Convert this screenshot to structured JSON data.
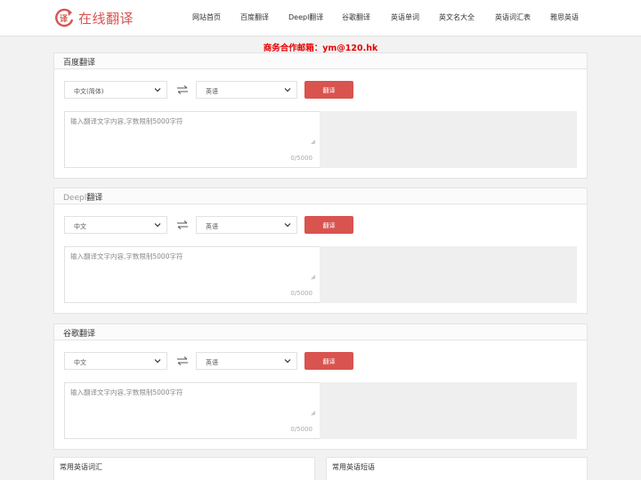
{
  "header": {
    "logo_text": "在线翻译",
    "logo_badge": "译",
    "nav": [
      "网站首页",
      "百度翻译",
      "Deepl翻译",
      "谷歌翻译",
      "英语单词",
      "英文名大全",
      "英语词汇表",
      "雅思英语"
    ]
  },
  "notice": "商务合作邮箱：ym@120.hk",
  "panels": [
    {
      "title": "百度翻译",
      "source_lang": "中文(简体)",
      "target_lang": "英语",
      "button": "翻译",
      "placeholder": "输入翻译文字内容,字数限制5000字符",
      "counter": "0/5000"
    },
    {
      "title_light": "Deepl",
      "title": "翻译",
      "source_lang": "中文",
      "target_lang": "英语",
      "button": "翻译",
      "placeholder": "输入翻译文字内容,字数限制5000字符",
      "counter": "0/5000"
    },
    {
      "title": "谷歌翻译",
      "source_lang": "中文",
      "target_lang": "英语",
      "button": "翻译",
      "placeholder": "输入翻译文字内容,字数限制5000字符",
      "counter": "0/5000"
    }
  ],
  "bottom_cards": [
    "常用英语词汇",
    "常用英语短语"
  ],
  "colors": {
    "accent": "#d9534f",
    "notice": "#e60000",
    "background": "#f2f2f2"
  },
  "icons": [
    "refresh-translate-icon",
    "chevron-down-icon",
    "swap-arrows-icon",
    "resize-grip-icon"
  ]
}
